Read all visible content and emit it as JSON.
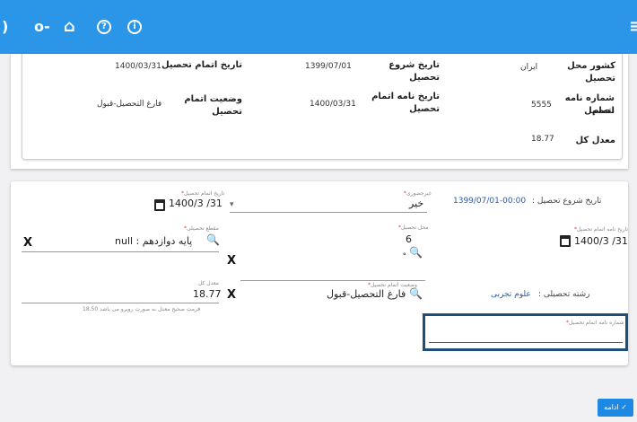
{
  "toolbar": {
    "icons": [
      "power-icon",
      "key-icon",
      "home-icon",
      "help-icon",
      "info-icon",
      "menu-icon"
    ],
    "glyphs": {
      "power": ")",
      "key": "o-",
      "home": "⌂",
      "help": "?",
      "info": "i",
      "menu": "≡"
    }
  },
  "summary": {
    "country_label": "کشور محل تحصیل",
    "country_value": "ایران",
    "start_date_label": "تاریخ شروع تحصیل",
    "start_date_value": "1399/07/01",
    "end_date_label": "تاریخ اتمام تحصیل",
    "end_date_value": "1400/03/31",
    "cert_number_label_1": "شماره نامه اتمام",
    "cert_number_label_2": "تحصیل",
    "cert_number_value": "5555",
    "cert_date_label_1": "تاریخ نامه اتمام",
    "cert_date_label_2": "تحصیل",
    "cert_date_value": "1400/03/31",
    "status_label_1": "وضعیت اتمام",
    "status_label_2": "تحصیل",
    "status_value": "فارغ التحصیل-قبول",
    "gpa_label": "معدل کل",
    "gpa_value": "18.77"
  },
  "form": {
    "start_date_label": "تاریخ شروع تحصیل :",
    "start_date_value": "1399/07/01-00:00",
    "attendance_label": "غیرحضوری",
    "attendance_value": "خیر",
    "end_date_label": "تاریخ اتمام تحصیل",
    "end_date_value": "1400/3 /31",
    "cert_date_label": "تاریخ نامه اتمام تحصیل",
    "cert_date_value": "1400/3 /31",
    "place_label": "محل تحصیل",
    "place_value": "6",
    "place_suffix": "ه",
    "grade_label": "مقطع تحصیلی",
    "grade_value": "null : پایه دوازدهم",
    "field_label": "رشته تحصیلی :",
    "field_value": "علوم تجربی",
    "status_label": "وضعیت اتمام تحصیل",
    "status_value": "فارغ التحصیل-قبول",
    "gpa_label": "معدل کل",
    "gpa_value": "18.77",
    "gpa_hint": "فرمت صحیح معدل به صورت روبرو می باشد 18.50",
    "cert_number_label": "شماره نامه اتمام تحصیل",
    "cert_number_value": "",
    "clear_glyph": "X",
    "required_mark": "*",
    "search_glyph": "🔍",
    "dropdown_glyph": "▾"
  },
  "footer": {
    "continue_label": "ادامه",
    "continue_glyph": "✓"
  }
}
